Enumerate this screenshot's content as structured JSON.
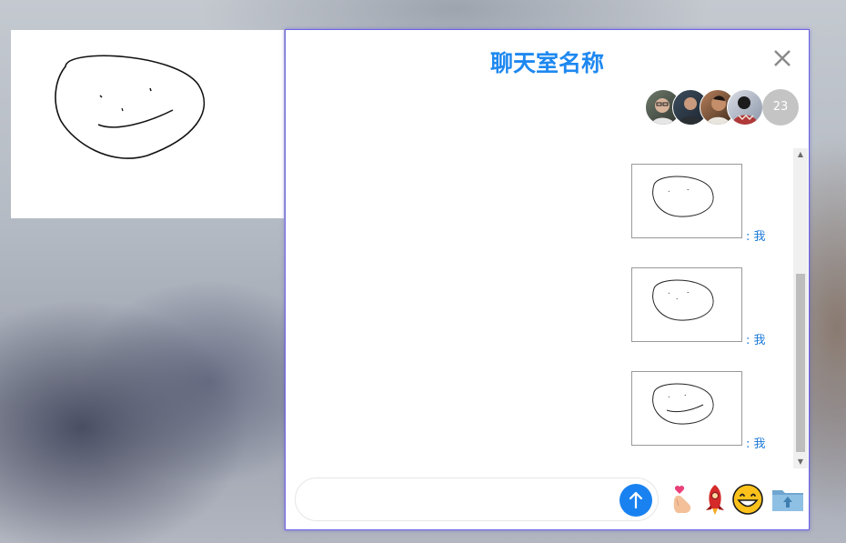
{
  "chat": {
    "title": "聊天室名称",
    "member_count": "23",
    "avatars": [
      "avatar-1",
      "avatar-2",
      "avatar-3",
      "avatar-4"
    ],
    "messages": [
      {
        "sender": ": 我",
        "type": "drawing"
      },
      {
        "sender": ": 我",
        "type": "drawing"
      },
      {
        "sender": ": 我",
        "type": "drawing"
      }
    ],
    "input": {
      "value": "",
      "placeholder": ""
    }
  },
  "icons": {
    "close": "close-icon",
    "send": "arrow-up-icon",
    "emoji_heart": "finger-heart-emoji",
    "emoji_rocket": "rocket-emoji",
    "emoji_grin": "grinning-face-emoji",
    "upload": "folder-upload-icon"
  },
  "colors": {
    "accent": "#1e88f0",
    "send_button": "#1a82f0",
    "border": "#6c63e6",
    "name_text": "#1e7bd8"
  }
}
